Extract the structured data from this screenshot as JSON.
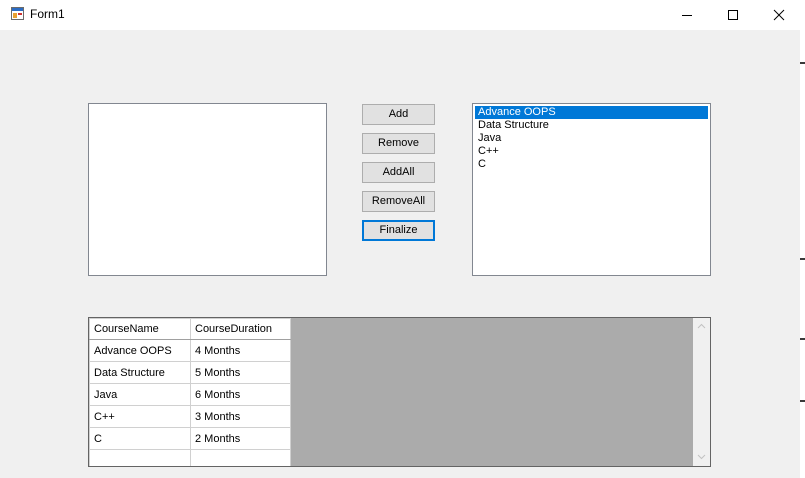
{
  "window": {
    "title": "Form1",
    "icons": {
      "app": "form-app-icon",
      "minimize": "minimize-icon",
      "maximize": "maximize-icon",
      "close": "close-icon"
    }
  },
  "left_list": {
    "items": []
  },
  "right_list": {
    "items": [
      "Advance OOPS",
      "Data Structure",
      "Java",
      "C++",
      "C"
    ],
    "selected_index": 0
  },
  "buttons": {
    "add": "Add",
    "remove": "Remove",
    "add_all": "AddAll",
    "remove_all": "RemoveAll",
    "finalize": "Finalize"
  },
  "grid": {
    "columns": [
      "CourseName",
      "CourseDuration"
    ],
    "rows": [
      [
        "Advance OOPS",
        "4 Months"
      ],
      [
        "Data Structure",
        "5 Months"
      ],
      [
        "Java",
        "6 Months"
      ],
      [
        "C++",
        "3 Months"
      ],
      [
        "C",
        "2 Months"
      ]
    ]
  },
  "colors": {
    "selection": "#0078d7",
    "form_bg": "#f0f0f0",
    "grid_bg": "#ababab"
  }
}
